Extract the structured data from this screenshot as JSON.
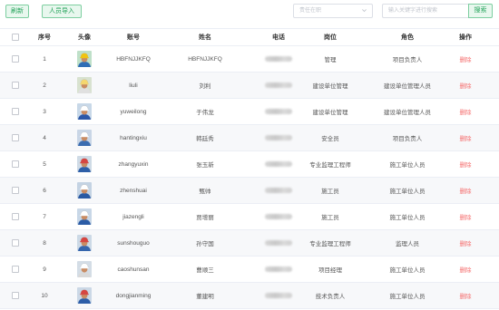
{
  "toolbar": {
    "refresh_label": "刷新",
    "import_label": "人员导入",
    "filter_placeholder": "责任在职",
    "search_placeholder": "输入关键字进行搜索",
    "search_label": "搜索"
  },
  "table": {
    "headers": {
      "seq": "序号",
      "avatar": "头像",
      "account": "账号",
      "name": "姓名",
      "phone": "电话",
      "post": "岗位",
      "role": "角色",
      "op": "操作"
    },
    "delete_label": "删除",
    "rows": [
      {
        "seq": "1",
        "account": "HBFNJJKFQ",
        "name": "HBFNJJKFQ",
        "phone": "",
        "post": "管理",
        "role": "项目负责人",
        "avatar": {
          "helmet": "#f1c40f",
          "shirt": "#2f6db5",
          "bg": "#bfe0c9"
        }
      },
      {
        "seq": "2",
        "account": "liuli",
        "name": "刘利",
        "phone": "",
        "post": "建设单位管理",
        "role": "建设单位管理人员",
        "avatar": {
          "helmet": "#f5d76e",
          "shirt": "#e0e0e0",
          "bg": "#d8e2d0"
        }
      },
      {
        "seq": "3",
        "account": "yuweilong",
        "name": "于伟龙",
        "phone": "",
        "post": "建设单位管理",
        "role": "建设单位管理人员",
        "avatar": {
          "helmet": "#ffffff",
          "shirt": "#2b57a8",
          "bg": "#c8d8e8"
        }
      },
      {
        "seq": "4",
        "account": "hantingxiu",
        "name": "韩廷秀",
        "phone": "",
        "post": "安全员",
        "role": "项目负责人",
        "avatar": {
          "helmet": "#ffffff",
          "shirt": "#3a6cb0",
          "bg": "#c9d6e6"
        }
      },
      {
        "seq": "5",
        "account": "zhangyuxin",
        "name": "张玉新",
        "phone": "",
        "post": "专业监理工程师",
        "role": "施工单位人员",
        "avatar": {
          "helmet": "#d64541",
          "shirt": "#2e5fa8",
          "bg": "#cfdbe6"
        }
      },
      {
        "seq": "6",
        "account": "zhenshuai",
        "name": "甄帅",
        "phone": "",
        "post": "施工员",
        "role": "施工单位人员",
        "avatar": {
          "helmet": "#ffffff",
          "shirt": "#2a5aa3",
          "bg": "#c4d3e3"
        }
      },
      {
        "seq": "7",
        "account": "jiazengli",
        "name": "贾增丽",
        "phone": "",
        "post": "施工员",
        "role": "施工单位人员",
        "avatar": {
          "helmet": "#ffffff",
          "shirt": "#2b5ca6",
          "bg": "#c8d7e7"
        }
      },
      {
        "seq": "8",
        "account": "sunshouguo",
        "name": "孙守国",
        "phone": "",
        "post": "专业监理工程师",
        "role": "监理人员",
        "avatar": {
          "helmet": "#d64541",
          "shirt": "#3565ad",
          "bg": "#ccd9e6"
        }
      },
      {
        "seq": "9",
        "account": "caoshunsan",
        "name": "曹顺三",
        "phone": "",
        "post": "项目经理",
        "role": "施工单位人员",
        "avatar": {
          "helmet": "#ffffff",
          "shirt": "#d9d9d9",
          "bg": "#d4dde6"
        }
      },
      {
        "seq": "10",
        "account": "dongjianming",
        "name": "董建明",
        "phone": "",
        "post": "技术负责人",
        "role": "施工单位人员",
        "avatar": {
          "helmet": "#d64541",
          "shirt": "#2e5ea8",
          "bg": "#cbd8e6"
        }
      }
    ]
  }
}
